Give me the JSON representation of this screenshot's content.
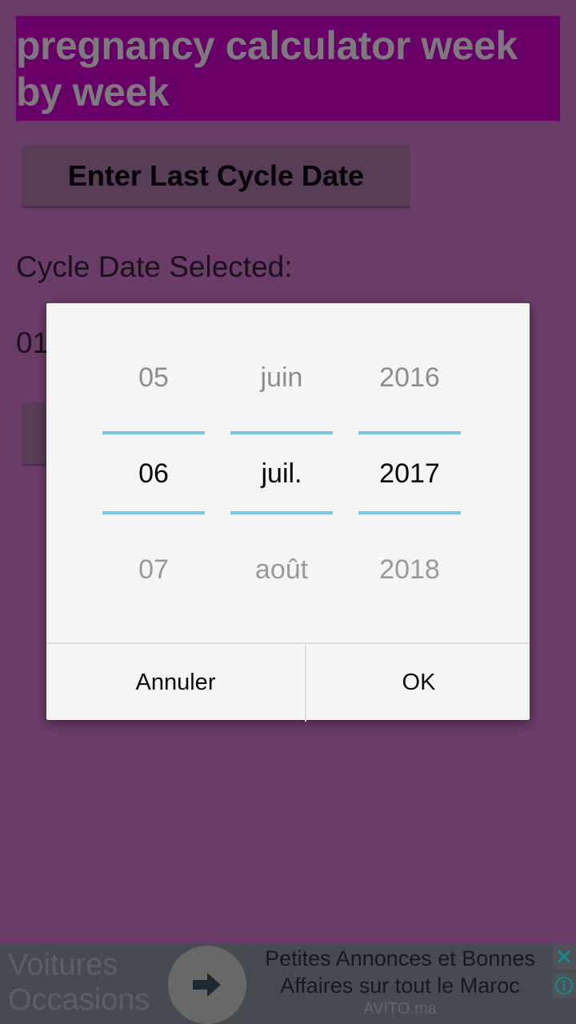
{
  "app": {
    "title": "pregnancy calculator week by week",
    "enter_button_label": "Enter Last Cycle Date",
    "cycle_label": "Cycle Date Selected:",
    "cycle_value_partial": "01"
  },
  "colors": {
    "background": "#6a3d69",
    "title_bar": "#690068",
    "title_text": "#7d7a7d",
    "button_bg": "#573d56",
    "picker_divider": "#7ac6dc",
    "dialog_bg": "#f5f5f5"
  },
  "date_picker": {
    "columns": [
      {
        "name": "day",
        "prev": "05",
        "selected": "06",
        "next": "07"
      },
      {
        "name": "month",
        "prev": "juin",
        "selected": "juil.",
        "next": "août"
      },
      {
        "name": "year",
        "prev": "2016",
        "selected": "2017",
        "next": "2018"
      }
    ],
    "cancel_label": "Annuler",
    "ok_label": "OK"
  },
  "ad": {
    "left_text_line1": "Voitures",
    "left_text_line2": "Occasions",
    "headline_line1": "Petites Annonces et Bonnes",
    "headline_line2": "Affaires sur tout le Maroc",
    "domain": "AVITO.ma",
    "arrow_icon": "arrow-right-icon",
    "close_icon": "close-icon",
    "info_icon": "info-icon"
  }
}
